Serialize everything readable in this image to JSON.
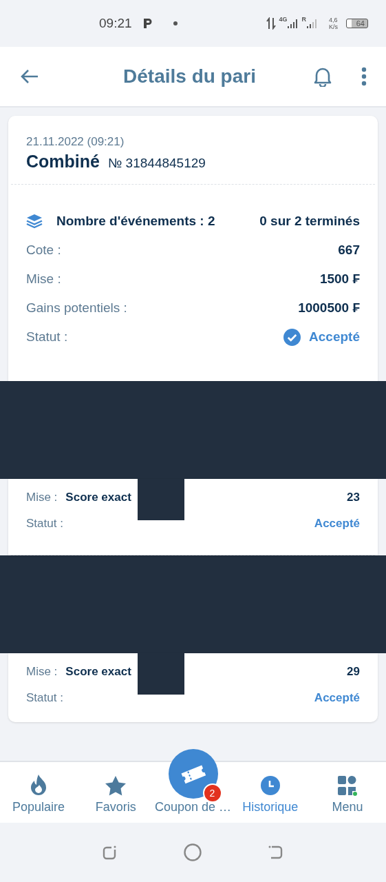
{
  "status_bar": {
    "time": "09:21",
    "network": "4G",
    "roaming": "R",
    "speed": "4,6",
    "speed_unit": "K/s",
    "battery": "64"
  },
  "header": {
    "title": "Détails du pari"
  },
  "bet": {
    "date": "21.11.2022 (09:21)",
    "type": "Combiné",
    "number": "№ 31844845129",
    "events_label": "Nombre d'événements : 2",
    "events_progress": "0 sur 2 terminés",
    "rows": [
      {
        "label": "Cote :",
        "value": "667"
      },
      {
        "label": "Mise :",
        "value": "1500 ₣"
      },
      {
        "label": "Gains potentiels :",
        "value": "1000500 ₣"
      }
    ],
    "status_label": "Statut :",
    "status": "Accepté"
  },
  "legs": [
    {
      "label": "Mise :",
      "market": "Score exact",
      "value": "23",
      "status_label": "Statut :",
      "status": "Accepté"
    },
    {
      "label": "Mise :",
      "market": "Score exact",
      "value": "29",
      "status_label": "Statut :",
      "status": "Accepté"
    }
  ],
  "nav": [
    {
      "kind": "flame",
      "label": "Populaire",
      "selected": false
    },
    {
      "kind": "star",
      "label": "Favoris",
      "selected": false
    },
    {
      "kind": "coupon",
      "label": "Coupon de …",
      "selected": false,
      "badge": "2"
    },
    {
      "kind": "clock",
      "label": "Historique",
      "selected": true
    },
    {
      "kind": "grid",
      "label": "Menu",
      "selected": false
    }
  ]
}
